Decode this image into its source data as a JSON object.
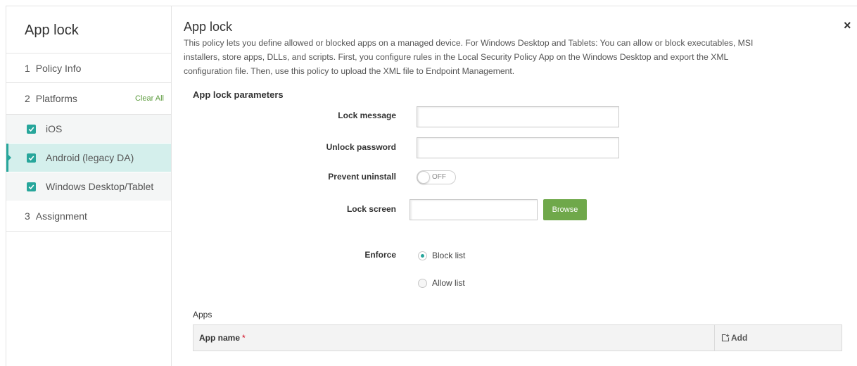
{
  "sidebar": {
    "title": "App lock",
    "checkbox_icon": "checkmark-icon",
    "steps": {
      "policy_info": {
        "number": "1",
        "label": "Policy Info"
      },
      "platforms": {
        "number": "2",
        "label": "Platforms",
        "clear_all_label": "Clear All"
      },
      "assignment": {
        "number": "3",
        "label": "Assignment"
      }
    },
    "platforms": [
      {
        "label": "iOS",
        "checked": true,
        "active": false
      },
      {
        "label": "Android (legacy DA)",
        "checked": true,
        "active": true
      },
      {
        "label": "Windows Desktop/Tablet",
        "checked": true,
        "active": false
      }
    ]
  },
  "main": {
    "title": "App lock",
    "close_icon": "close-icon",
    "close_glyph": "×",
    "description_lines": [
      "This policy lets you define allowed or blocked apps on a managed device. For Windows Desktop and Tablets: You can allow or block executables, MSI",
      "installers, store apps, DLLs, and scripts. First, you configure rules in the Local Security Policy App on the Windows Desktop and export the XML",
      "configuration file. Then, use this policy to upload the XML file to Endpoint Management."
    ],
    "section_title": "App lock parameters",
    "fields": {
      "lock_message": {
        "label": "Lock message",
        "value": ""
      },
      "unlock_password": {
        "label": "Unlock password",
        "value": ""
      },
      "prevent_uninstall": {
        "label": "Prevent uninstall",
        "on": false,
        "state_label": "OFF"
      },
      "lock_screen": {
        "label": "Lock screen",
        "value": "",
        "browse_label": "Browse"
      },
      "enforce": {
        "label": "Enforce",
        "options": [
          "Block list",
          "Allow list"
        ],
        "selected_index": 0
      }
    },
    "apps": {
      "label": "Apps",
      "columns": [
        {
          "label": "App name",
          "required_marker": "*"
        }
      ],
      "add_label": "Add",
      "add_icon": "add-icon",
      "rows": []
    }
  },
  "colors": {
    "accent": "#27a69b",
    "button_green": "#6fa84a",
    "active_row": "#d4efec",
    "link_green": "#5c9b3d",
    "required_red": "#d0021b"
  }
}
